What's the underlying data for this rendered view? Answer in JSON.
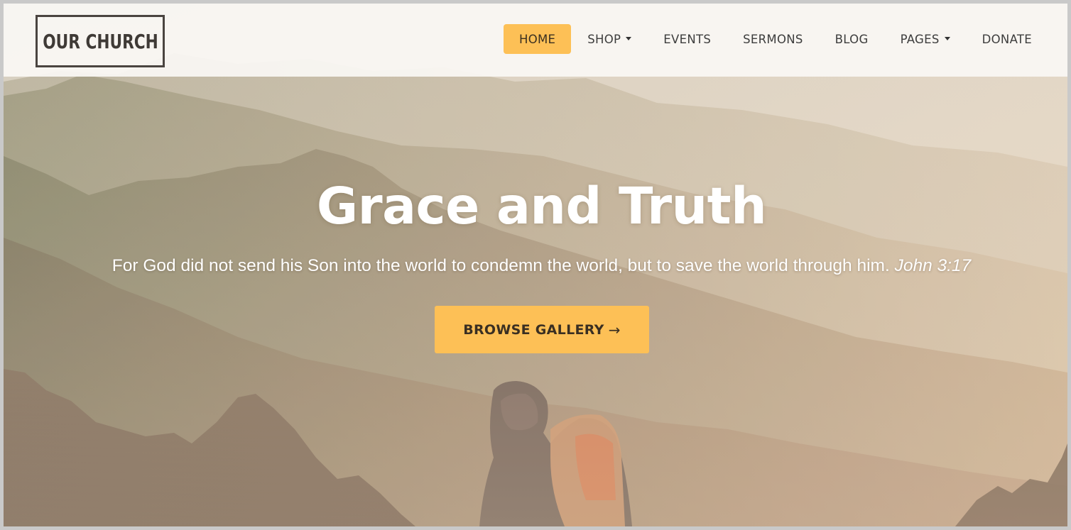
{
  "header": {
    "logo_text": "OUR CHURCH"
  },
  "nav": {
    "items": [
      {
        "label": "HOME",
        "active": true,
        "has_dropdown": false
      },
      {
        "label": "SHOP",
        "active": false,
        "has_dropdown": true
      },
      {
        "label": "EVENTS",
        "active": false,
        "has_dropdown": false
      },
      {
        "label": "SERMONS",
        "active": false,
        "has_dropdown": false
      },
      {
        "label": "BLOG",
        "active": false,
        "has_dropdown": false
      },
      {
        "label": "PAGES",
        "active": false,
        "has_dropdown": true
      },
      {
        "label": "DONATE",
        "active": false,
        "has_dropdown": false
      }
    ]
  },
  "hero": {
    "title": "Grace and Truth",
    "verse_text": "For God did not send his Son into the world to condemn the world, but to save the world through him.",
    "verse_reference": "John 3:17",
    "button_label": "BROWSE GALLERY",
    "button_arrow": "→"
  },
  "colors": {
    "accent": "#fdc056",
    "header_bg": "#faf8f4",
    "text_dark": "#3d3d3d",
    "hero_text": "#ffffff"
  },
  "icons": {
    "dropdown": "caret-down-icon",
    "button_arrow": "arrow-right-icon"
  }
}
